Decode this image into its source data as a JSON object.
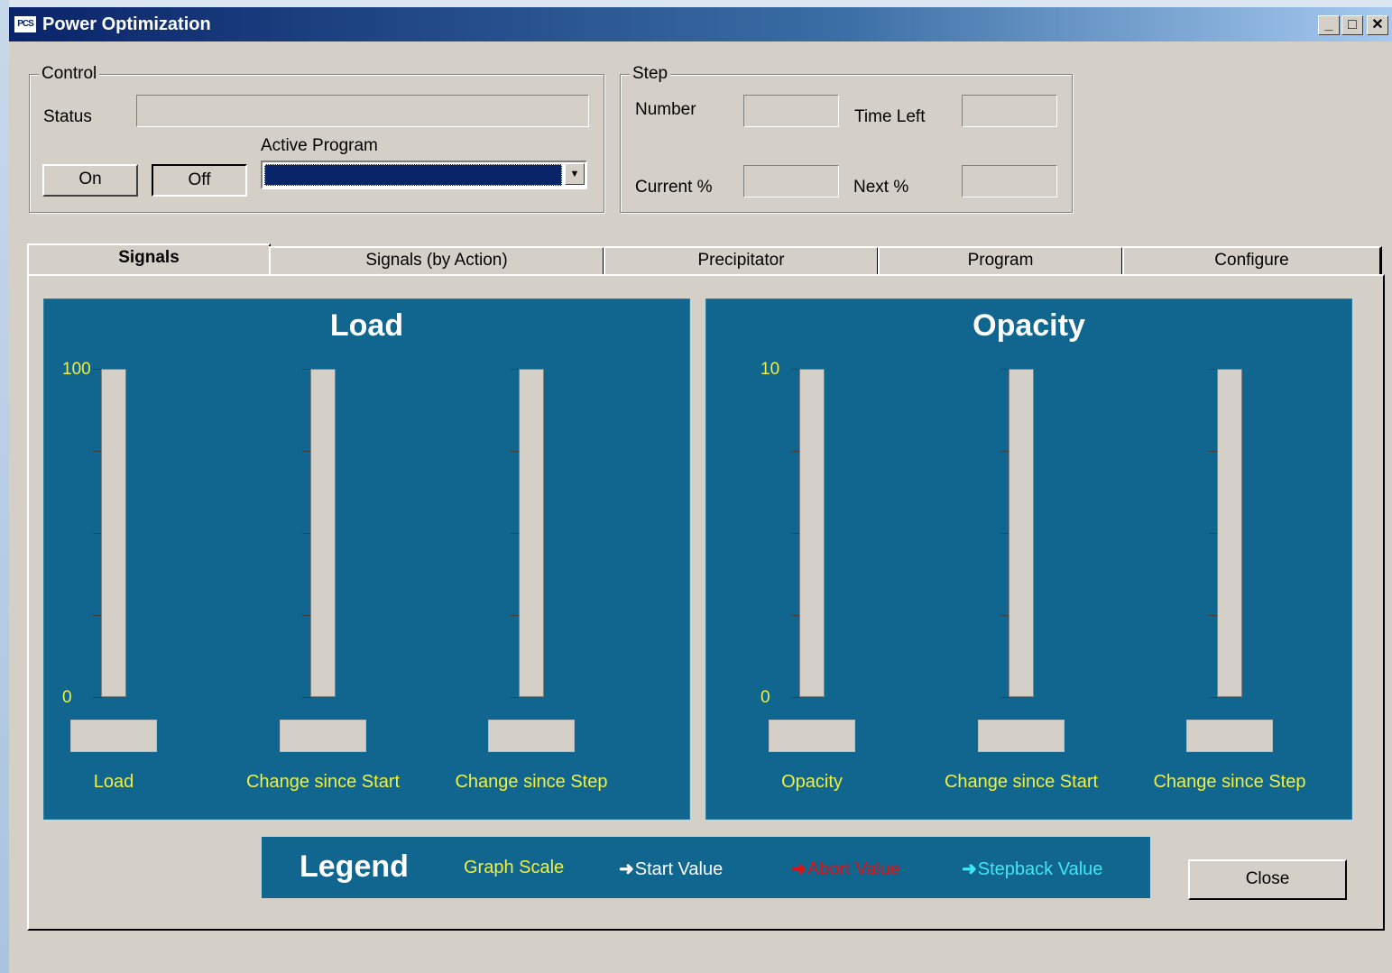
{
  "window": {
    "title": "Power Optimization",
    "icon": "PCS"
  },
  "titlebar_buttons": {
    "minimize": "_",
    "maximize": "□",
    "close": "✕"
  },
  "control": {
    "legend": "Control",
    "status_label": "Status",
    "status_value": "",
    "active_program_label": "Active Program",
    "active_program_value": "",
    "on_label": "On",
    "off_label": "Off"
  },
  "step": {
    "legend": "Step",
    "number_label": "Number",
    "number_value": "",
    "time_left_label": "Time Left",
    "time_left_value": "",
    "current_label": "Current %",
    "current_value": "",
    "next_label": "Next %",
    "next_value": ""
  },
  "tabs": [
    {
      "label": "Signals",
      "active": true
    },
    {
      "label": "Signals (by Action)",
      "active": false
    },
    {
      "label": "Precipitator",
      "active": false
    },
    {
      "label": "Program",
      "active": false
    },
    {
      "label": "Configure",
      "active": false
    }
  ],
  "panels": [
    {
      "title": "Load",
      "scale_max": "100",
      "scale_min": "0",
      "bars": [
        {
          "caption": "Load",
          "value": "",
          "level": 0
        },
        {
          "caption": "Change since Start",
          "value": "",
          "level": 0
        },
        {
          "caption": "Change since Step",
          "value": "",
          "level": 0
        }
      ]
    },
    {
      "title": "Opacity",
      "scale_max": "10",
      "scale_min": "0",
      "bars": [
        {
          "caption": "Opacity",
          "value": "",
          "level": 0
        },
        {
          "caption": "Change since Start",
          "value": "",
          "level": 0
        },
        {
          "caption": "Change since Step",
          "value": "",
          "level": 0
        }
      ]
    }
  ],
  "legend": {
    "title": "Legend",
    "graph_scale": "Graph Scale",
    "start_value": "Start Value",
    "abort_value": "Abort Value",
    "stepback_value": "Stepback Value",
    "arrow": "➜",
    "colors": {
      "graph_scale": "#f0f040",
      "start_value": "#ffffff",
      "abort_value": "#e01010",
      "stepback_value": "#40e8f0"
    }
  },
  "close_label": "Close",
  "colors": {
    "panel_bg": "#11668f",
    "scale_text": "#f0f040"
  }
}
